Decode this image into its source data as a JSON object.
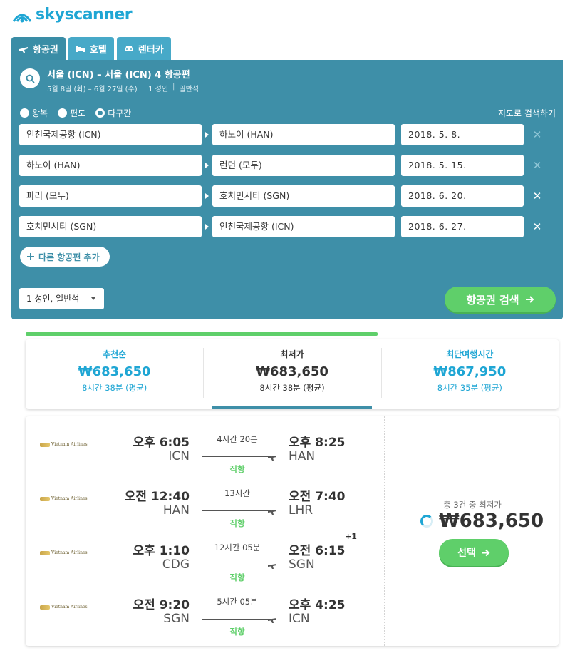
{
  "brand": {
    "name": "skyscanner",
    "color": "#1fa6d4"
  },
  "tabs": [
    {
      "label": "항공권",
      "icon": "plane-icon",
      "active": true
    },
    {
      "label": "호텔",
      "icon": "bed-icon",
      "active": false
    },
    {
      "label": "렌터카",
      "icon": "car-icon",
      "active": false
    }
  ],
  "summary": {
    "title": "서울 (ICN) – 서울 (ICN) 4 항공편",
    "dates": "5월 8일 (화) – 6월 27일 (수)",
    "pax": "1 성인",
    "cabin": "일반석"
  },
  "trip_types": [
    {
      "label": "왕복",
      "selected": false
    },
    {
      "label": "편도",
      "selected": false
    },
    {
      "label": "다구간",
      "selected": true
    }
  ],
  "map_link": "지도로 검색하기",
  "legs": [
    {
      "from": "인천국제공항 (ICN)",
      "to": "하노이 (HAN)",
      "date": "2018. 5. 8.",
      "removable": false
    },
    {
      "from": "하노이 (HAN)",
      "to": "런던 (모두)",
      "date": "2018. 5. 15.",
      "removable": false
    },
    {
      "from": "파리 (모두)",
      "to": "호치민시티 (SGN)",
      "date": "2018. 6. 20.",
      "removable": true
    },
    {
      "from": "호치민시티 (SGN)",
      "to": "인천국제공항 (ICN)",
      "date": "2018. 6. 27.",
      "removable": true
    }
  ],
  "add_leg_label": "다른 항공편 추가",
  "pax_select": "1 성인, 일반석",
  "search_button": "항공권 검색",
  "sort_tabs": [
    {
      "label": "추천순",
      "price": "₩683,650",
      "time": "8시간 38분 (평균)",
      "active": false
    },
    {
      "label": "최저가",
      "price": "₩683,650",
      "time": "8시간 38분 (평균)",
      "active": true
    },
    {
      "label": "최단여행시간",
      "price": "₩867,950",
      "time": "8시간 35분 (평균)",
      "active": false
    }
  ],
  "result": {
    "airline": "Vietnam Airlines",
    "flights": [
      {
        "dep_time": "오후 6:05",
        "dep_code": "ICN",
        "duration": "4시간 20분",
        "stops": "직항",
        "arr_time": "오후 8:25",
        "arr_code": "HAN",
        "day_offset": ""
      },
      {
        "dep_time": "오전 12:40",
        "dep_code": "HAN",
        "duration": "13시간",
        "stops": "직항",
        "arr_time": "오전 7:40",
        "arr_code": "LHR",
        "day_offset": ""
      },
      {
        "dep_time": "오후 1:10",
        "dep_code": "CDG",
        "duration": "12시간 05분",
        "stops": "직항",
        "arr_time": "오전 6:15",
        "arr_code": "SGN",
        "day_offset": "+1"
      },
      {
        "dep_time": "오전 9:20",
        "dep_code": "SGN",
        "duration": "5시간 05분",
        "stops": "직항",
        "arr_time": "오후 4:25",
        "arr_code": "ICN",
        "day_offset": ""
      }
    ],
    "price_caption": "총 3건 중 최저가",
    "price": "₩683,650",
    "select_button": "선택"
  },
  "colors": {
    "panel": "#3e8fa8",
    "green": "#5fcf6a",
    "accent": "#1fa6d4"
  }
}
